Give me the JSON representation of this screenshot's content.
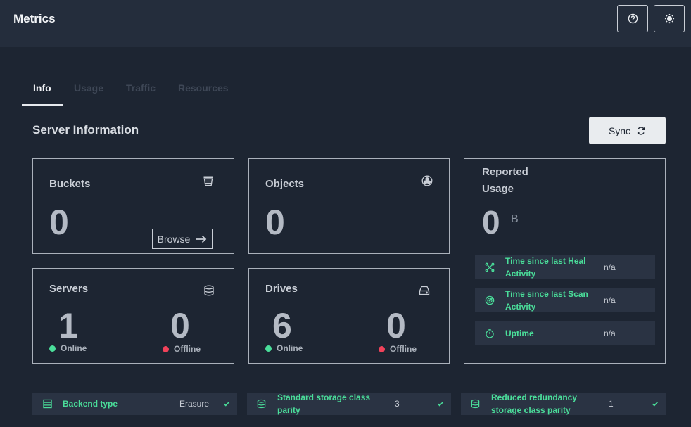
{
  "header": {
    "title": "Metrics",
    "help_icon": "help-circle-icon",
    "theme_icon": "sun-icon"
  },
  "tabs": [
    {
      "label": "Info",
      "active": true
    },
    {
      "label": "Usage",
      "active": false
    },
    {
      "label": "Traffic",
      "active": false
    },
    {
      "label": "Resources",
      "active": false
    }
  ],
  "section": {
    "title": "Server Information",
    "sync_label": "Sync"
  },
  "buckets": {
    "label": "Buckets",
    "value": "0",
    "browse_label": "Browse"
  },
  "objects": {
    "label": "Objects",
    "value": "0"
  },
  "servers": {
    "label": "Servers",
    "online": "1",
    "online_label": "Online",
    "offline": "0",
    "offline_label": "Offline"
  },
  "drives": {
    "label": "Drives",
    "online": "6",
    "online_label": "Online",
    "offline": "0",
    "offline_label": "Offline"
  },
  "usage": {
    "label": "Reported Usage",
    "value": "0",
    "unit": "B",
    "rows": [
      {
        "label": "Time since last Heal Activity",
        "value": "n/a"
      },
      {
        "label": "Time since last Scan Activity",
        "value": "n/a"
      },
      {
        "label": "Uptime",
        "value": "n/a"
      }
    ]
  },
  "bottom": [
    {
      "label": "Backend type",
      "value": "Erasure"
    },
    {
      "label": "Standard storage class parity",
      "value": "3"
    },
    {
      "label": "Reduced redundancy storage class parity",
      "value": "1"
    }
  ],
  "colors": {
    "accent": "#4ade9a",
    "offline": "#f1425a",
    "background": "#1d2532",
    "header": "#242d3c"
  }
}
